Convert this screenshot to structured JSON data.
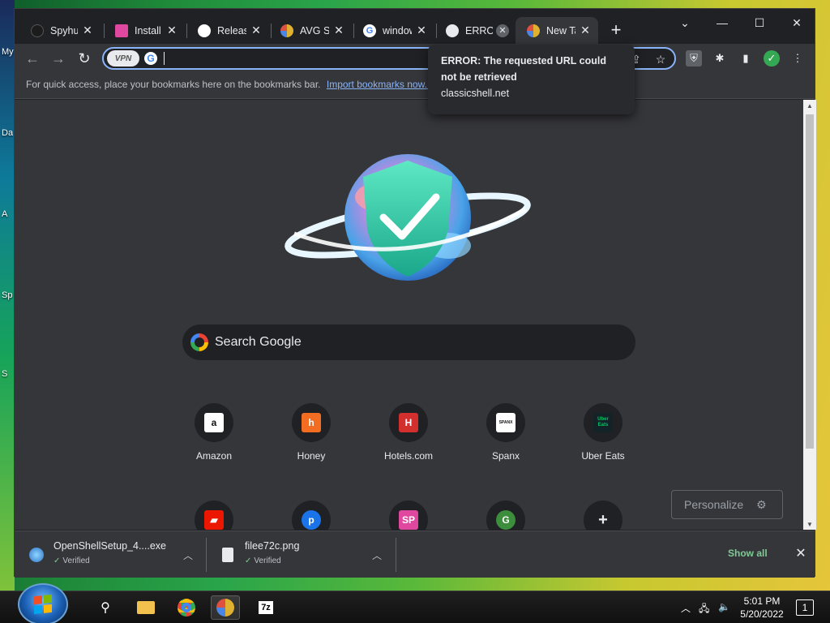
{
  "desktop": {
    "fragments": [
      "My",
      "Da",
      "A",
      "Sp",
      "S"
    ]
  },
  "browser": {
    "tabs": [
      {
        "title": "Spyhunter",
        "icon": "spyhunter-icon",
        "color": "#3a3a3a"
      },
      {
        "title": "Install Classic",
        "icon": "sp-icon",
        "color": "#e0479e"
      },
      {
        "title": "Releases",
        "icon": "github-icon",
        "color": "#ffffff"
      },
      {
        "title": "AVG Secure",
        "icon": "avg-browser-icon",
        "color": "#e0b030"
      },
      {
        "title": "windows",
        "icon": "google-icon",
        "color": "#ffffff"
      },
      {
        "title": "ERROR",
        "icon": "globe-icon",
        "color": "#e8eaed"
      },
      {
        "title": "New Tab",
        "icon": "avg-browser-icon",
        "color": "#e0b030"
      }
    ],
    "window_controls": {
      "minimize": "—",
      "maximize": "☐",
      "close": "✕",
      "dropdown": "⌄"
    },
    "omnibox": {
      "vpn_label": "VPN",
      "value": ""
    },
    "bookmarks_bar": {
      "text": "For quick access, place your bookmarks here on the bookmarks bar.",
      "link": "Import bookmarks now..."
    },
    "tooltip": {
      "title": "ERROR: The requested URL could not be retrieved",
      "url": "classicshell.net"
    }
  },
  "newtab": {
    "search_placeholder": "Search Google",
    "shortcuts_row1": [
      {
        "label": "Amazon",
        "glyph": "a",
        "bg": "#ffffff",
        "fg": "#111111"
      },
      {
        "label": "Honey",
        "glyph": "h",
        "bg": "#f26c22",
        "fg": "#ffffff"
      },
      {
        "label": "Hotels.com",
        "glyph": "H",
        "bg": "#d32f2f",
        "fg": "#ffffff"
      },
      {
        "label": "Spanx",
        "glyph": "SPANX",
        "bg": "#ffffff",
        "fg": "#111111"
      },
      {
        "label": "Uber Eats",
        "glyph": "Uber Eats",
        "bg": "#142328",
        "fg": "#06c167"
      }
    ],
    "shortcuts_row2": [
      {
        "glyph": "▰",
        "bg": "#eb1700",
        "fg": "#ffffff"
      },
      {
        "glyph": "p",
        "bg": "#1a73e8",
        "fg": "#ffffff"
      },
      {
        "glyph": "SP",
        "bg": "#e0479e",
        "fg": "#ffffff"
      },
      {
        "glyph": "G",
        "bg": "#3c8d3c",
        "fg": "#ffffff"
      },
      {
        "glyph": "+",
        "bg": "#202124",
        "fg": "#e8eaed"
      }
    ],
    "personalize_label": "Personalize"
  },
  "downloads": {
    "items": [
      {
        "name": "OpenShellSetup_4....exe",
        "status": "Verified"
      },
      {
        "name": "filee72c.png",
        "status": "Verified"
      }
    ],
    "show_all": "Show all"
  },
  "taskbar": {
    "clock_time": "5:01 PM",
    "clock_date": "5/20/2022",
    "notification_count": "1"
  },
  "colors": {
    "accent": "#8ab4f8",
    "verified": "#81c995",
    "surface": "#35363a",
    "background": "#202124"
  }
}
